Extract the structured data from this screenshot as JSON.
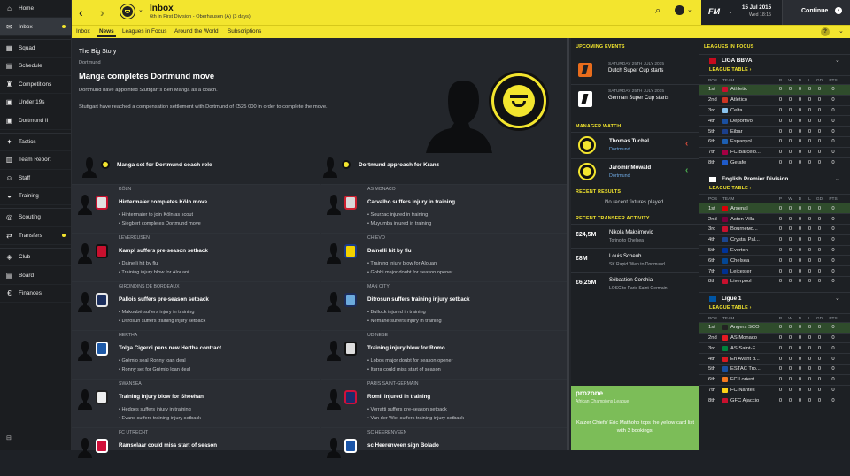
{
  "sidebar": {
    "items": [
      {
        "label": "Home",
        "icon": "home-icon",
        "glyph": "⌂"
      },
      {
        "label": "Inbox",
        "icon": "inbox-icon",
        "glyph": "✉",
        "active": true,
        "badge": true
      },
      {
        "label": "Squad",
        "icon": "squad-icon",
        "glyph": "▦"
      },
      {
        "label": "Schedule",
        "icon": "calendar-icon",
        "glyph": "▤"
      },
      {
        "label": "Competitions",
        "icon": "trophy-icon",
        "glyph": "♜"
      },
      {
        "label": "Under 19s",
        "icon": "under19-icon",
        "glyph": "▣"
      },
      {
        "label": "Dortmund II",
        "icon": "reserve-icon",
        "glyph": "▣"
      },
      {
        "label": "Tactics",
        "icon": "tactics-icon",
        "glyph": "✦"
      },
      {
        "label": "Team Report",
        "icon": "report-icon",
        "glyph": "▥"
      },
      {
        "label": "Staff",
        "icon": "staff-icon",
        "glyph": "☺"
      },
      {
        "label": "Training",
        "icon": "training-icon",
        "glyph": "◒"
      },
      {
        "label": "Scouting",
        "icon": "scouting-icon",
        "glyph": "◎"
      },
      {
        "label": "Transfers",
        "icon": "transfers-icon",
        "glyph": "⇄",
        "badge": true
      },
      {
        "label": "Club",
        "icon": "club-icon",
        "glyph": "◈"
      },
      {
        "label": "Board",
        "icon": "board-icon",
        "glyph": "▤"
      },
      {
        "label": "Finances",
        "icon": "finances-icon",
        "glyph": "€"
      }
    ],
    "footer_glyph": "⊟"
  },
  "topbar": {
    "title": "Inbox",
    "subtitle": "6th in First Division - Oberhausen (A) (3 days)",
    "brand": "FM",
    "date": "15 Jul 2015",
    "time": "Wed 18:15",
    "continue": "Continue"
  },
  "subnav": {
    "tabs": [
      "Inbox",
      "News",
      "Leagues in Focus",
      "Around the World",
      "Subscriptions"
    ],
    "active": 1,
    "help": "?"
  },
  "bigstory": {
    "label": "The Big Story",
    "club": "Dortmund",
    "headline": "Manga completes Dortmund move",
    "p1": "Dortmund have appointed Stuttgart's Ben Manga as a coach.",
    "p2": "Stuttgart have reached a compensation settlement with Dortmund of €525 000 in order to complete the move.",
    "related": [
      "Manga set for Dortmund coach role",
      "Dortmund approach for Kranz"
    ]
  },
  "news": [
    {
      "club": "Köln",
      "title": "Hintermaier completes Köln move",
      "b1": "Hintermaier to join Köln as scout",
      "b2": "Siegbert completes Dortmund move",
      "color": "#e0e0e0",
      "stroke": "#c8102e"
    },
    {
      "club": "AS Monaco",
      "title": "Carvalho suffers injury in training",
      "b1": "Sourzac injured in training",
      "b2": "Muyumba injured in training",
      "color": "#d8d8d8",
      "stroke": "#cc1f2f"
    },
    {
      "club": "Leverkusen",
      "title": "Kampl suffers pre-season setback",
      "b1": "Dainelli hit by flu",
      "b2": "Training injury blow for Alouani",
      "color": "#c8102e",
      "stroke": "#111"
    },
    {
      "club": "Chievo",
      "title": "Dainelli hit by flu",
      "b1": "Training injury blow for Alouani",
      "b2": "Gobbi major doubt for season opener",
      "color": "#f2d200",
      "stroke": "#1a3b8c"
    },
    {
      "club": "Girondins de Bordeaux",
      "title": "Pallois suffers pre-season setback",
      "b1": "Makoubé suffers injury in training",
      "b2": "Ditrosun suffers training injury setback",
      "color": "#1c2f5e",
      "stroke": "#e8e8e8"
    },
    {
      "club": "Man City",
      "title": "Ditrosun suffers training injury setback",
      "b1": "Bullock injured in training",
      "b2": "Nemane suffers injury in training",
      "color": "#6cabdd",
      "stroke": "#1c2c5b"
    },
    {
      "club": "Hertha",
      "title": "Tolga Cigerci pens new Hertha contract",
      "b1": "Grémio seal Ronny loan deal",
      "b2": "Ronny set for Grémio loan deal",
      "color": "#1e5aa8",
      "stroke": "#fff"
    },
    {
      "club": "Udinese",
      "title": "Training injury blow for Romo",
      "b1": "Lobos major doubt for season opener",
      "b2": "Iturra could miss start of season",
      "color": "#ddd",
      "stroke": "#111"
    },
    {
      "club": "Swansea",
      "title": "Training injury blow for Sheehan",
      "b1": "Hedges suffers injury in training",
      "b2": "Evans suffers training injury setback",
      "color": "#eee",
      "stroke": "#222"
    },
    {
      "club": "Paris Saint-Germain",
      "title": "Romil injured in training",
      "b1": "Verratti suffers pre-season setback",
      "b2": "Van der Wiel suffers training injury setback",
      "color": "#1a2d6b",
      "stroke": "#d0103a"
    },
    {
      "club": "FC Utrecht",
      "title": "Ramselaar could miss start of season",
      "b1": "",
      "b2": "",
      "color": "#d0103a",
      "stroke": "#fff"
    },
    {
      "club": "SC Heerenveen",
      "title": "sc Heerenveen sign Bolado",
      "b1": "",
      "b2": "",
      "color": "#1b55a8",
      "stroke": "#fff"
    }
  ],
  "upcoming": {
    "title": "UPCOMING EVENTS",
    "events": [
      {
        "date": "SATURDAY 25TH JULY 2015",
        "name": "Dutch Super Cup starts"
      },
      {
        "date": "SATURDAY 25TH JULY 2015",
        "name": "German Super Cup starts"
      }
    ]
  },
  "watch": {
    "title": "MANAGER WATCH",
    "managers": [
      {
        "name": "Thomas Tuchel",
        "club": "Dortmund",
        "trend": "‹",
        "trend_color": "#d04a3a"
      },
      {
        "name": "Jaromír Möwald",
        "club": "Dortmund",
        "trend": "‹",
        "trend_color": "#4caf50"
      }
    ]
  },
  "results": {
    "title": "RECENT RESULTS",
    "text": "No recent fixtures played."
  },
  "transfers": {
    "title": "RECENT TRANSFER ACTIVITY",
    "items": [
      {
        "fee": "€24,5M",
        "name": "Nikola Maksimovic",
        "detail": "Torino to Chelsea"
      },
      {
        "fee": "€8M",
        "name": "Louis Scheub",
        "detail": "SK Rapid Wien to Dortmund"
      },
      {
        "fee": "€6,25M",
        "name": "Sébastien Corchia",
        "detail": "LOSC to Paris Saint-Germain"
      }
    ]
  },
  "prozone": {
    "brand": "prozone",
    "league": "African Champions League",
    "text": "Kaizer Chiefs' Eric Mathoho tops the yellow card list with 3 bookings."
  },
  "leagues": {
    "title": "LEAGUES IN FOCUS",
    "table_label": "LEAGUE TABLE ›",
    "cols": [
      "POS",
      "TEAM",
      "P",
      "W",
      "D",
      "L",
      "GD",
      "PTS"
    ],
    "tables": [
      {
        "name": "LIGA BBVA",
        "flag": "#c60b1e",
        "rows": [
          [
            "1st",
            "Athletic",
            "0",
            "0",
            "0",
            "0",
            "0",
            "0",
            "#c8102e"
          ],
          [
            "2nd",
            "Atlético",
            "0",
            "0",
            "0",
            "0",
            "0",
            "0",
            "#cb3524"
          ],
          [
            "3rd",
            "Celta",
            "0",
            "0",
            "0",
            "0",
            "0",
            "0",
            "#8ac3ee"
          ],
          [
            "4th",
            "Deportivo",
            "0",
            "0",
            "0",
            "0",
            "0",
            "0",
            "#1a4fa0"
          ],
          [
            "5th",
            "Eibar",
            "0",
            "0",
            "0",
            "0",
            "0",
            "0",
            "#1b3f8b"
          ],
          [
            "6th",
            "Espanyol",
            "0",
            "0",
            "0",
            "0",
            "0",
            "0",
            "#1d5fb2"
          ],
          [
            "7th",
            "FC Barcelo...",
            "0",
            "0",
            "0",
            "0",
            "0",
            "0",
            "#a50044"
          ],
          [
            "8th",
            "Getafe",
            "0",
            "0",
            "0",
            "0",
            "0",
            "0",
            "#1f5ac8"
          ]
        ]
      },
      {
        "name": "English Premier Division",
        "flag": "#ffffff",
        "rows": [
          [
            "1st",
            "Arsenal",
            "0",
            "0",
            "0",
            "0",
            "0",
            "0",
            "#db0007"
          ],
          [
            "2nd",
            "Aston Villa",
            "0",
            "0",
            "0",
            "0",
            "0",
            "0",
            "#7a003c"
          ],
          [
            "3rd",
            "Bourneмо...",
            "0",
            "0",
            "0",
            "0",
            "0",
            "0",
            "#c8102e"
          ],
          [
            "4th",
            "Crystal Pal...",
            "0",
            "0",
            "0",
            "0",
            "0",
            "0",
            "#1b458f"
          ],
          [
            "5th",
            "Everton",
            "0",
            "0",
            "0",
            "0",
            "0",
            "0",
            "#003399"
          ],
          [
            "6th",
            "Chelsea",
            "0",
            "0",
            "0",
            "0",
            "0",
            "0",
            "#034694"
          ],
          [
            "7th",
            "Leicester",
            "0",
            "0",
            "0",
            "0",
            "0",
            "0",
            "#003090"
          ],
          [
            "8th",
            "Liverpool",
            "0",
            "0",
            "0",
            "0",
            "0",
            "0",
            "#c8102e"
          ]
        ]
      },
      {
        "name": "Ligue 1",
        "flag": "#0055a4",
        "rows": [
          [
            "1st",
            "Angers SCO",
            "0",
            "0",
            "0",
            "0",
            "0",
            "0",
            "#222"
          ],
          [
            "2nd",
            "AS Monaco",
            "0",
            "0",
            "0",
            "0",
            "0",
            "0",
            "#e51b22"
          ],
          [
            "3rd",
            "AS Saint-E...",
            "0",
            "0",
            "0",
            "0",
            "0",
            "0",
            "#00843d"
          ],
          [
            "4th",
            "En Avant d...",
            "0",
            "0",
            "0",
            "0",
            "0",
            "0",
            "#d71920"
          ],
          [
            "5th",
            "ESTAC Tro...",
            "0",
            "0",
            "0",
            "0",
            "0",
            "0",
            "#1a4fa0"
          ],
          [
            "6th",
            "FC Lorient",
            "0",
            "0",
            "0",
            "0",
            "0",
            "0",
            "#f47920"
          ],
          [
            "7th",
            "FC Nantes",
            "0",
            "0",
            "0",
            "0",
            "0",
            "0",
            "#fcd116"
          ],
          [
            "8th",
            "GFC Ajaccio",
            "0",
            "0",
            "0",
            "0",
            "0",
            "0",
            "#c8102e"
          ]
        ]
      }
    ]
  }
}
